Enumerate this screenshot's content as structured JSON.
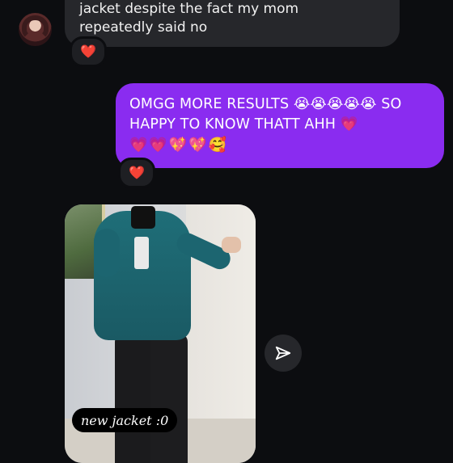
{
  "thread": {
    "incoming_message": {
      "text": "jacket despite the fact my mom\nrepeatedly said no",
      "reaction": "❤️"
    },
    "outgoing_message": {
      "text": "OMGG MORE RESULTS 😭😭😭😭😭 SO HAPPY TO KNOW THATT AHH 💗",
      "emojis": "💗💗💖💖🥰",
      "reaction": "❤️"
    },
    "photo_message": {
      "caption": "new jacket :0"
    }
  },
  "icons": {
    "avatar": "avatar",
    "share": "send-icon"
  },
  "colors": {
    "background": "#0c0d10",
    "incoming_bubble": "#26272b",
    "outgoing_bubble": "#8a2cf0"
  }
}
